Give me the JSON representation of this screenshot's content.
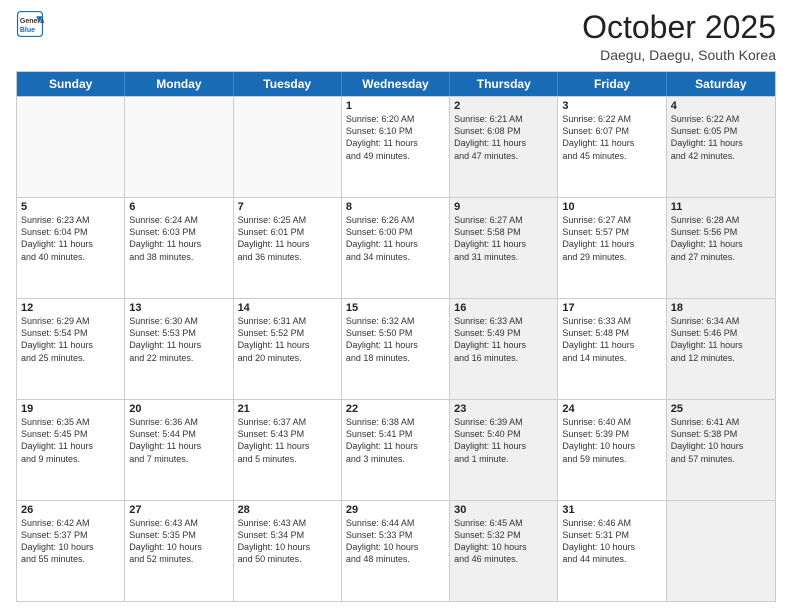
{
  "logo": {
    "line1": "General",
    "line2": "Blue"
  },
  "title": "October 2025",
  "subtitle": "Daegu, Daegu, South Korea",
  "header_days": [
    "Sunday",
    "Monday",
    "Tuesday",
    "Wednesday",
    "Thursday",
    "Friday",
    "Saturday"
  ],
  "rows": [
    [
      {
        "day": "",
        "info": "",
        "shaded": false,
        "empty": true
      },
      {
        "day": "",
        "info": "",
        "shaded": false,
        "empty": true
      },
      {
        "day": "",
        "info": "",
        "shaded": false,
        "empty": true
      },
      {
        "day": "1",
        "info": "Sunrise: 6:20 AM\nSunset: 6:10 PM\nDaylight: 11 hours\nand 49 minutes.",
        "shaded": false,
        "empty": false
      },
      {
        "day": "2",
        "info": "Sunrise: 6:21 AM\nSunset: 6:08 PM\nDaylight: 11 hours\nand 47 minutes.",
        "shaded": true,
        "empty": false
      },
      {
        "day": "3",
        "info": "Sunrise: 6:22 AM\nSunset: 6:07 PM\nDaylight: 11 hours\nand 45 minutes.",
        "shaded": false,
        "empty": false
      },
      {
        "day": "4",
        "info": "Sunrise: 6:22 AM\nSunset: 6:05 PM\nDaylight: 11 hours\nand 42 minutes.",
        "shaded": true,
        "empty": false
      }
    ],
    [
      {
        "day": "5",
        "info": "Sunrise: 6:23 AM\nSunset: 6:04 PM\nDaylight: 11 hours\nand 40 minutes.",
        "shaded": false,
        "empty": false
      },
      {
        "day": "6",
        "info": "Sunrise: 6:24 AM\nSunset: 6:03 PM\nDaylight: 11 hours\nand 38 minutes.",
        "shaded": false,
        "empty": false
      },
      {
        "day": "7",
        "info": "Sunrise: 6:25 AM\nSunset: 6:01 PM\nDaylight: 11 hours\nand 36 minutes.",
        "shaded": false,
        "empty": false
      },
      {
        "day": "8",
        "info": "Sunrise: 6:26 AM\nSunset: 6:00 PM\nDaylight: 11 hours\nand 34 minutes.",
        "shaded": false,
        "empty": false
      },
      {
        "day": "9",
        "info": "Sunrise: 6:27 AM\nSunset: 5:58 PM\nDaylight: 11 hours\nand 31 minutes.",
        "shaded": true,
        "empty": false
      },
      {
        "day": "10",
        "info": "Sunrise: 6:27 AM\nSunset: 5:57 PM\nDaylight: 11 hours\nand 29 minutes.",
        "shaded": false,
        "empty": false
      },
      {
        "day": "11",
        "info": "Sunrise: 6:28 AM\nSunset: 5:56 PM\nDaylight: 11 hours\nand 27 minutes.",
        "shaded": true,
        "empty": false
      }
    ],
    [
      {
        "day": "12",
        "info": "Sunrise: 6:29 AM\nSunset: 5:54 PM\nDaylight: 11 hours\nand 25 minutes.",
        "shaded": false,
        "empty": false
      },
      {
        "day": "13",
        "info": "Sunrise: 6:30 AM\nSunset: 5:53 PM\nDaylight: 11 hours\nand 22 minutes.",
        "shaded": false,
        "empty": false
      },
      {
        "day": "14",
        "info": "Sunrise: 6:31 AM\nSunset: 5:52 PM\nDaylight: 11 hours\nand 20 minutes.",
        "shaded": false,
        "empty": false
      },
      {
        "day": "15",
        "info": "Sunrise: 6:32 AM\nSunset: 5:50 PM\nDaylight: 11 hours\nand 18 minutes.",
        "shaded": false,
        "empty": false
      },
      {
        "day": "16",
        "info": "Sunrise: 6:33 AM\nSunset: 5:49 PM\nDaylight: 11 hours\nand 16 minutes.",
        "shaded": true,
        "empty": false
      },
      {
        "day": "17",
        "info": "Sunrise: 6:33 AM\nSunset: 5:48 PM\nDaylight: 11 hours\nand 14 minutes.",
        "shaded": false,
        "empty": false
      },
      {
        "day": "18",
        "info": "Sunrise: 6:34 AM\nSunset: 5:46 PM\nDaylight: 11 hours\nand 12 minutes.",
        "shaded": true,
        "empty": false
      }
    ],
    [
      {
        "day": "19",
        "info": "Sunrise: 6:35 AM\nSunset: 5:45 PM\nDaylight: 11 hours\nand 9 minutes.",
        "shaded": false,
        "empty": false
      },
      {
        "day": "20",
        "info": "Sunrise: 6:36 AM\nSunset: 5:44 PM\nDaylight: 11 hours\nand 7 minutes.",
        "shaded": false,
        "empty": false
      },
      {
        "day": "21",
        "info": "Sunrise: 6:37 AM\nSunset: 5:43 PM\nDaylight: 11 hours\nand 5 minutes.",
        "shaded": false,
        "empty": false
      },
      {
        "day": "22",
        "info": "Sunrise: 6:38 AM\nSunset: 5:41 PM\nDaylight: 11 hours\nand 3 minutes.",
        "shaded": false,
        "empty": false
      },
      {
        "day": "23",
        "info": "Sunrise: 6:39 AM\nSunset: 5:40 PM\nDaylight: 11 hours\nand 1 minute.",
        "shaded": true,
        "empty": false
      },
      {
        "day": "24",
        "info": "Sunrise: 6:40 AM\nSunset: 5:39 PM\nDaylight: 10 hours\nand 59 minutes.",
        "shaded": false,
        "empty": false
      },
      {
        "day": "25",
        "info": "Sunrise: 6:41 AM\nSunset: 5:38 PM\nDaylight: 10 hours\nand 57 minutes.",
        "shaded": true,
        "empty": false
      }
    ],
    [
      {
        "day": "26",
        "info": "Sunrise: 6:42 AM\nSunset: 5:37 PM\nDaylight: 10 hours\nand 55 minutes.",
        "shaded": false,
        "empty": false
      },
      {
        "day": "27",
        "info": "Sunrise: 6:43 AM\nSunset: 5:35 PM\nDaylight: 10 hours\nand 52 minutes.",
        "shaded": false,
        "empty": false
      },
      {
        "day": "28",
        "info": "Sunrise: 6:43 AM\nSunset: 5:34 PM\nDaylight: 10 hours\nand 50 minutes.",
        "shaded": false,
        "empty": false
      },
      {
        "day": "29",
        "info": "Sunrise: 6:44 AM\nSunset: 5:33 PM\nDaylight: 10 hours\nand 48 minutes.",
        "shaded": false,
        "empty": false
      },
      {
        "day": "30",
        "info": "Sunrise: 6:45 AM\nSunset: 5:32 PM\nDaylight: 10 hours\nand 46 minutes.",
        "shaded": true,
        "empty": false
      },
      {
        "day": "31",
        "info": "Sunrise: 6:46 AM\nSunset: 5:31 PM\nDaylight: 10 hours\nand 44 minutes.",
        "shaded": false,
        "empty": false
      },
      {
        "day": "",
        "info": "",
        "shaded": true,
        "empty": true
      }
    ]
  ]
}
